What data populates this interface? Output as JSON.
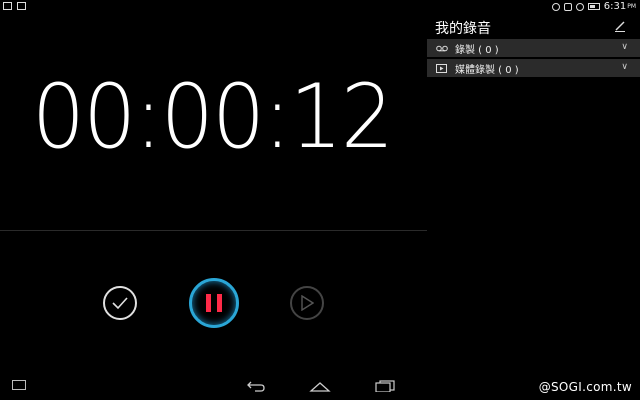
{
  "status_bar": {
    "time": "6:31",
    "ampm": "PM"
  },
  "recorder": {
    "timer": "00:00:12"
  },
  "panel": {
    "title": "我的錄音",
    "sections": [
      {
        "label": "錄製 ( 0 )",
        "icon": "voicemail-icon"
      },
      {
        "label": "媒體錄製 ( 0 )",
        "icon": "video-icon"
      }
    ]
  },
  "colors": {
    "accent_ring": "#2aa6d6",
    "pause_red": "#ff2a48",
    "section_bg": "#2b2b2b"
  },
  "watermark": "@SOGI.com.tw"
}
